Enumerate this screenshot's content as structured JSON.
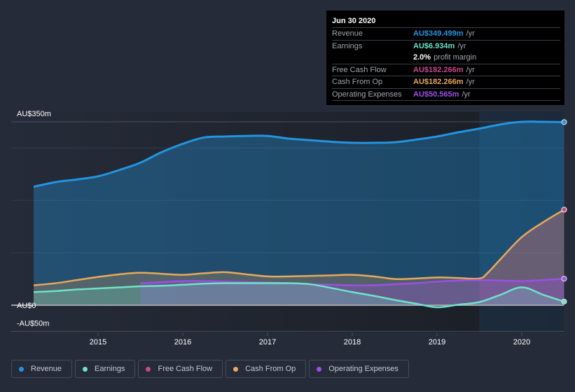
{
  "tooltip": {
    "date": "Jun 30 2020",
    "rows": [
      {
        "label": "Revenue",
        "value": "AU$349.499m",
        "unit": "/yr",
        "color": "#2394df"
      },
      {
        "label": "Earnings",
        "value": "AU$6.934m",
        "unit": "/yr",
        "color": "#6ee3c9"
      },
      {
        "label": "",
        "value": "2.0%",
        "unit": "profit margin",
        "color": "#ffffff"
      },
      {
        "label": "Free Cash Flow",
        "value": "AU$182.266m",
        "unit": "/yr",
        "color": "#c9488c"
      },
      {
        "label": "Cash From Op",
        "value": "AU$182.266m",
        "unit": "/yr",
        "color": "#e8a95b"
      },
      {
        "label": "Operating Expenses",
        "value": "AU$50.565m",
        "unit": "/yr",
        "color": "#9d4fe6"
      }
    ]
  },
  "legend": [
    {
      "label": "Revenue",
      "color": "#2394df"
    },
    {
      "label": "Earnings",
      "color": "#6ee3c9"
    },
    {
      "label": "Free Cash Flow",
      "color": "#c9488c"
    },
    {
      "label": "Cash From Op",
      "color": "#e8a95b"
    },
    {
      "label": "Operating Expenses",
      "color": "#9d4fe6"
    }
  ],
  "chart_data": {
    "type": "area",
    "title": "",
    "xlabel": "",
    "ylabel": "",
    "ylim": [
      -50,
      350
    ],
    "xlim": [
      2014.24,
      2020.5
    ],
    "y_tick_labels": [
      {
        "value": 350,
        "label": "AU$350m"
      },
      {
        "value": 0,
        "label": "AU$0"
      },
      {
        "value": -50,
        "label": "-AU$50m"
      }
    ],
    "x_ticks": [
      2015,
      2016,
      2017,
      2018,
      2019,
      2020
    ],
    "x_tick_labels": [
      "2015",
      "2016",
      "2017",
      "2018",
      "2019",
      "2020"
    ],
    "grid": true,
    "legend_position": "bottom-left",
    "highlight_start": 2019.5,
    "series": [
      {
        "name": "Revenue",
        "color": "#2394df",
        "x": [
          2014.24,
          2014.5,
          2014.75,
          2015.0,
          2015.25,
          2015.5,
          2015.75,
          2016.0,
          2016.25,
          2016.5,
          2016.75,
          2017.0,
          2017.25,
          2017.5,
          2017.75,
          2018.0,
          2018.25,
          2018.5,
          2018.75,
          2019.0,
          2019.25,
          2019.5,
          2019.75,
          2020.0,
          2020.25,
          2020.5
        ],
        "values": [
          226,
          235,
          240,
          246,
          258,
          272,
          292,
          308,
          320,
          322,
          323,
          323,
          318,
          315,
          312,
          310,
          310,
          311,
          316,
          322,
          330,
          337,
          345,
          350,
          350,
          349.5
        ]
      },
      {
        "name": "Earnings",
        "color": "#6ee3c9",
        "x": [
          2014.24,
          2014.5,
          2014.75,
          2015.0,
          2015.25,
          2015.5,
          2015.75,
          2016.0,
          2016.25,
          2016.5,
          2016.75,
          2017.0,
          2017.25,
          2017.5,
          2017.75,
          2018.0,
          2018.25,
          2018.5,
          2018.75,
          2019.0,
          2019.25,
          2019.5,
          2019.75,
          2020.0,
          2020.25,
          2020.5
        ],
        "values": [
          25,
          27,
          30,
          32,
          34,
          36,
          37,
          39,
          41,
          42,
          42,
          42,
          42,
          40,
          33,
          25,
          18,
          10,
          3,
          -4,
          1,
          6,
          20,
          34,
          20,
          6.9
        ]
      },
      {
        "name": "Free Cash Flow",
        "color": "#c9488c",
        "x": [
          2019.5,
          2019.75,
          2020.0,
          2020.25,
          2020.5
        ],
        "values": [
          50,
          90,
          130,
          158,
          182.3
        ]
      },
      {
        "name": "Cash From Op",
        "color": "#e8a95b",
        "x": [
          2014.24,
          2014.5,
          2014.75,
          2015.0,
          2015.25,
          2015.5,
          2015.75,
          2016.0,
          2016.25,
          2016.5,
          2016.75,
          2017.0,
          2017.25,
          2017.5,
          2017.75,
          2018.0,
          2018.25,
          2018.5,
          2018.75,
          2019.0,
          2019.25,
          2019.5,
          2019.6,
          2019.75,
          2020.0,
          2020.25,
          2020.5
        ],
        "values": [
          38,
          42,
          48,
          54,
          59,
          62,
          60,
          58,
          61,
          63,
          59,
          55,
          55,
          56,
          57,
          58,
          55,
          50,
          51,
          53,
          52,
          51,
          62,
          88,
          130,
          158,
          182.3
        ]
      },
      {
        "name": "Operating Expenses",
        "color": "#9d4fe6",
        "x": [
          2015.5,
          2015.75,
          2016.0,
          2016.25,
          2016.5,
          2016.75,
          2017.0,
          2017.25,
          2017.5,
          2017.75,
          2018.0,
          2018.25,
          2018.5,
          2018.75,
          2019.0,
          2019.25,
          2019.5,
          2019.75,
          2020.0,
          2020.25,
          2020.5
        ],
        "values": [
          42,
          44,
          46,
          46,
          45,
          44,
          43,
          42,
          40,
          39,
          38,
          38,
          40,
          42,
          45,
          47,
          48,
          47,
          46,
          48,
          50.6
        ]
      }
    ]
  }
}
